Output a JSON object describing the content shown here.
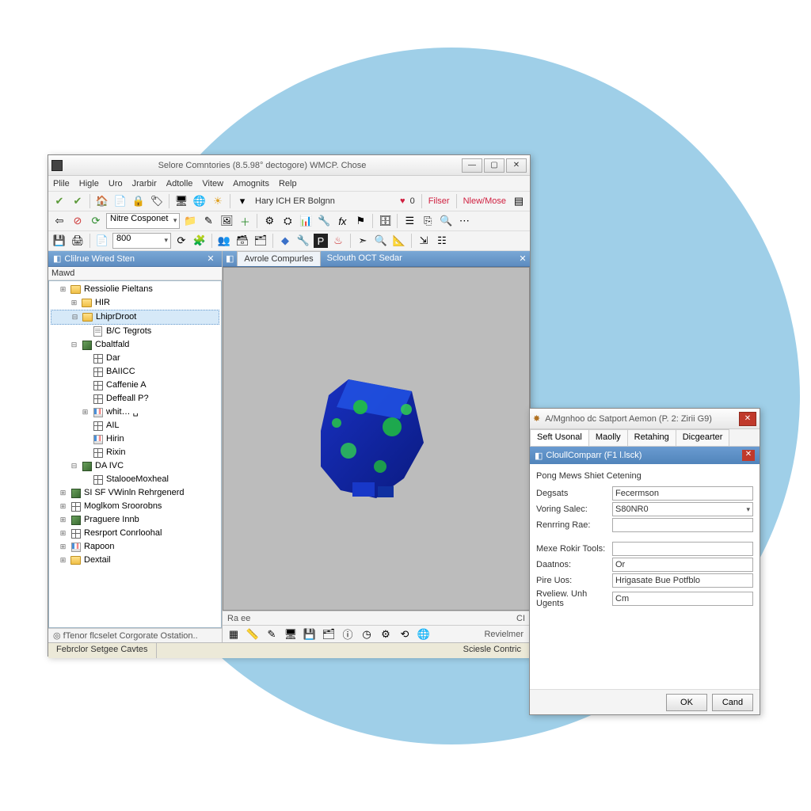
{
  "main_window": {
    "title": "Selore Comntories (8.5.98° dectogore) WMCP. Chose",
    "menu": [
      "Plile",
      "Higle",
      "Uro",
      "Jrarbir",
      "Adtolle",
      "Vitew",
      "Amognits",
      "Relp"
    ],
    "toolbar1": {
      "hint": "Hary ICH ER Bolgnn",
      "zero": "0",
      "filter": "Filser",
      "new": "Nlew/Mose"
    },
    "toolbar2": {
      "combo": "Nitre Cosponet"
    },
    "toolbar3": {
      "combo": "800"
    },
    "left_panel": {
      "title": "Clilrue Wired Sten",
      "nav_label": "Mawd",
      "status": "◎ fTenor flcselet Corgorate Ostation..",
      "tree": [
        {
          "t": "+",
          "ic": "folder",
          "lbl": "Ressiolie Pieltans",
          "ind": 1
        },
        {
          "t": "+",
          "ic": "folder",
          "lbl": "HIR",
          "ind": 2
        },
        {
          "t": "-",
          "ic": "folder",
          "lbl": "LhiprDroot",
          "ind": 2,
          "sel": true
        },
        {
          "t": "",
          "ic": "doc",
          "lbl": "B/C Tegrots",
          "ind": 3
        },
        {
          "t": "-",
          "ic": "cube",
          "lbl": "Cbaltfald",
          "ind": 2
        },
        {
          "t": "",
          "ic": "grid",
          "lbl": "Dar",
          "ind": 3
        },
        {
          "t": "",
          "ic": "grid",
          "lbl": "BAIICC",
          "ind": 3
        },
        {
          "t": "",
          "ic": "grid",
          "lbl": "Caffenie A",
          "ind": 3
        },
        {
          "t": "",
          "ic": "grid",
          "lbl": "Deffeall  P?",
          "ind": 3
        },
        {
          "t": "+",
          "ic": "bar",
          "lbl": "whit…  ␣",
          "ind": 3
        },
        {
          "t": "",
          "ic": "grid",
          "lbl": "AIL",
          "ind": 3
        },
        {
          "t": "",
          "ic": "bar",
          "lbl": "Hirin",
          "ind": 3
        },
        {
          "t": "",
          "ic": "grid",
          "lbl": "Rixin",
          "ind": 3
        },
        {
          "t": "-",
          "ic": "cube",
          "lbl": "DA IVC",
          "ind": 2
        },
        {
          "t": "",
          "ic": "grid",
          "lbl": "StalooeMoxheal",
          "ind": 3
        },
        {
          "t": "+",
          "ic": "cube",
          "lbl": "SI SF VWinln Rehrgenerd",
          "ind": 1
        },
        {
          "t": "+",
          "ic": "grid",
          "lbl": "Moglkom Sroorobns",
          "ind": 1
        },
        {
          "t": "+",
          "ic": "cube",
          "lbl": "Praguere Innb",
          "ind": 1
        },
        {
          "t": "+",
          "ic": "grid",
          "lbl": "Resrport Conrloohal",
          "ind": 1
        },
        {
          "t": "+",
          "ic": "bar",
          "lbl": "Rapoon",
          "ind": 1
        },
        {
          "t": "+",
          "ic": "folder",
          "lbl": "Dextail",
          "ind": 1
        }
      ]
    },
    "center_panel": {
      "tabs": [
        "Avrole Compurles",
        "Sclouth OCT Sedar"
      ],
      "footer_left": "Ra ee",
      "footer_cp": "CI",
      "status_right": "Revielmer"
    },
    "bottom_tabs": [
      "Febrclor Setgee Cavtes",
      "Sciesle Contric"
    ]
  },
  "dialog": {
    "title": "A/Mgnhoo dc Satport Aemon (P. 2: Zirii G9)",
    "tabs": [
      "Seft Usonal",
      "Maolly",
      "Retahing",
      "Dicgearter"
    ],
    "section_title": "CloullComparr (F1 l.lsck)",
    "group": "Pong Mews Shiet Cetening",
    "rows": [
      {
        "label": "Degsats",
        "value": "Fecermson",
        "combo": false
      },
      {
        "label": "Voring Salec:",
        "value": "S80NR0",
        "combo": true
      },
      {
        "label": "Renrring Rae:",
        "value": "",
        "combo": false
      },
      {
        "spacer": true
      },
      {
        "label": "Mexe Rokir Tools:",
        "value": "",
        "combo": false
      },
      {
        "label": "Daatnos:",
        "value": "Or",
        "combo": false
      },
      {
        "label": "Pire Uos:",
        "value": "Hrigasate Bue Potfblo",
        "combo": false
      },
      {
        "label": "Rveliew. Unh Ugents",
        "value": "Cm",
        "combo": false
      }
    ],
    "ok": "OK",
    "cancel": "Cand"
  }
}
